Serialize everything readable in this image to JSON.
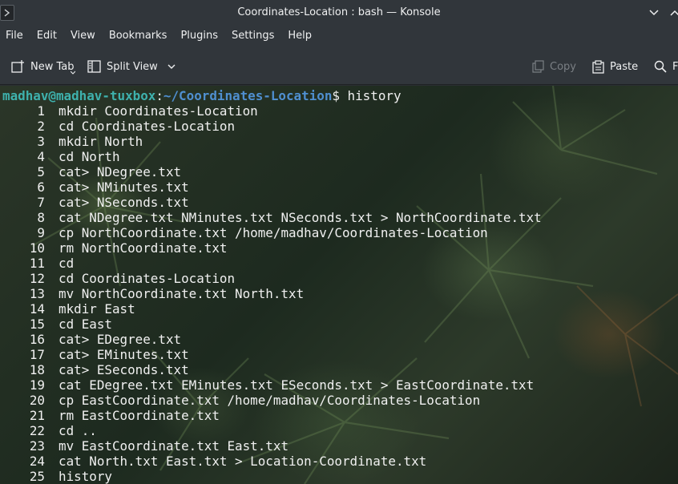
{
  "window": {
    "title": "Coordinates-Location : bash — Konsole",
    "min_icon": "chevron-down-icon",
    "max_icon": "chevron-up-icon"
  },
  "menubar": {
    "items": [
      "File",
      "Edit",
      "View",
      "Bookmarks",
      "Plugins",
      "Settings",
      "Help"
    ]
  },
  "toolbar": {
    "new_tab": "New Tab",
    "split_view": "Split View",
    "copy": "Copy",
    "paste": "Paste",
    "find": "F"
  },
  "terminal": {
    "prompt_user": "madhav@madhav-tuxbox",
    "prompt_sep": ":",
    "prompt_path": "~/Coordinates-Location",
    "prompt_symbol": "$ ",
    "command": "history",
    "history": [
      {
        "n": "1",
        "cmd": "mkdir Coordinates-Location"
      },
      {
        "n": "2",
        "cmd": "cd Coordinates-Location"
      },
      {
        "n": "3",
        "cmd": "mkdir North"
      },
      {
        "n": "4",
        "cmd": "cd North"
      },
      {
        "n": "5",
        "cmd": "cat> NDegree.txt"
      },
      {
        "n": "6",
        "cmd": "cat> NMinutes.txt"
      },
      {
        "n": "7",
        "cmd": "cat> NSeconds.txt"
      },
      {
        "n": "8",
        "cmd": "cat NDegree.txt NMinutes.txt NSeconds.txt > NorthCoordinate.txt"
      },
      {
        "n": "9",
        "cmd": "cp NorthCoordinate.txt /home/madhav/Coordinates-Location"
      },
      {
        "n": "10",
        "cmd": "rm NorthCoordinate.txt"
      },
      {
        "n": "11",
        "cmd": "cd"
      },
      {
        "n": "12",
        "cmd": "cd Coordinates-Location"
      },
      {
        "n": "13",
        "cmd": "mv NorthCoordinate.txt North.txt"
      },
      {
        "n": "14",
        "cmd": "mkdir East"
      },
      {
        "n": "15",
        "cmd": "cd East"
      },
      {
        "n": "16",
        "cmd": "cat> EDegree.txt"
      },
      {
        "n": "17",
        "cmd": "cat> EMinutes.txt"
      },
      {
        "n": "18",
        "cmd": "cat> ESeconds.txt"
      },
      {
        "n": "19",
        "cmd": "cat EDegree.txt EMinutes.txt ESeconds.txt > EastCoordinate.txt"
      },
      {
        "n": "20",
        "cmd": "cp EastCoordinate.txt /home/madhav/Coordinates-Location"
      },
      {
        "n": "21",
        "cmd": "rm EastCoordinate.txt"
      },
      {
        "n": "22",
        "cmd": "cd .."
      },
      {
        "n": "23",
        "cmd": "mv EastCoordinate.txt East.txt"
      },
      {
        "n": "24",
        "cmd": "cat North.txt East.txt > Location-Coordinate.txt"
      },
      {
        "n": "25",
        "cmd": "history"
      }
    ]
  }
}
